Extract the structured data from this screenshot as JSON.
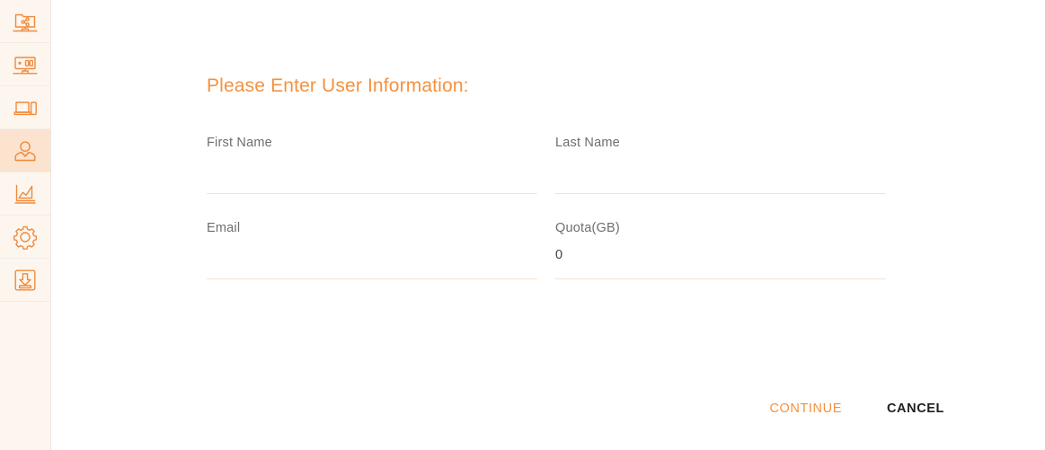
{
  "theme": {
    "accent": "#f5913e",
    "sidebar_bg": "#fdf6ef",
    "sidebar_active_bg": "#fbe3cf",
    "underline": "#f7e4cd",
    "label_color": "#6e6e70",
    "cancel_color": "#1f1f1f"
  },
  "sidebar": {
    "items": [
      {
        "name": "shared-folder",
        "icon": "shared-folder-icon",
        "active": false
      },
      {
        "name": "desktop-monitor",
        "icon": "monitor-icon",
        "active": false
      },
      {
        "name": "devices",
        "icon": "laptop-mobile-icon",
        "active": false
      },
      {
        "name": "users",
        "icon": "user-icon",
        "active": true
      },
      {
        "name": "reports",
        "icon": "chart-icon",
        "active": false
      },
      {
        "name": "settings",
        "icon": "gear-icon",
        "active": false
      },
      {
        "name": "downloads",
        "icon": "download-icon",
        "active": false
      }
    ]
  },
  "main": {
    "title": "Please Enter User Information:",
    "fields": [
      {
        "label": "First Name",
        "value": "",
        "placeholder": ""
      },
      {
        "label": "Last Name",
        "value": "",
        "placeholder": ""
      },
      {
        "label": "Email",
        "value": "",
        "placeholder": ""
      },
      {
        "label": "Quota(GB)",
        "value": "0",
        "placeholder": ""
      }
    ],
    "buttons": {
      "continue": "CONTINUE",
      "cancel": "CANCEL"
    }
  }
}
